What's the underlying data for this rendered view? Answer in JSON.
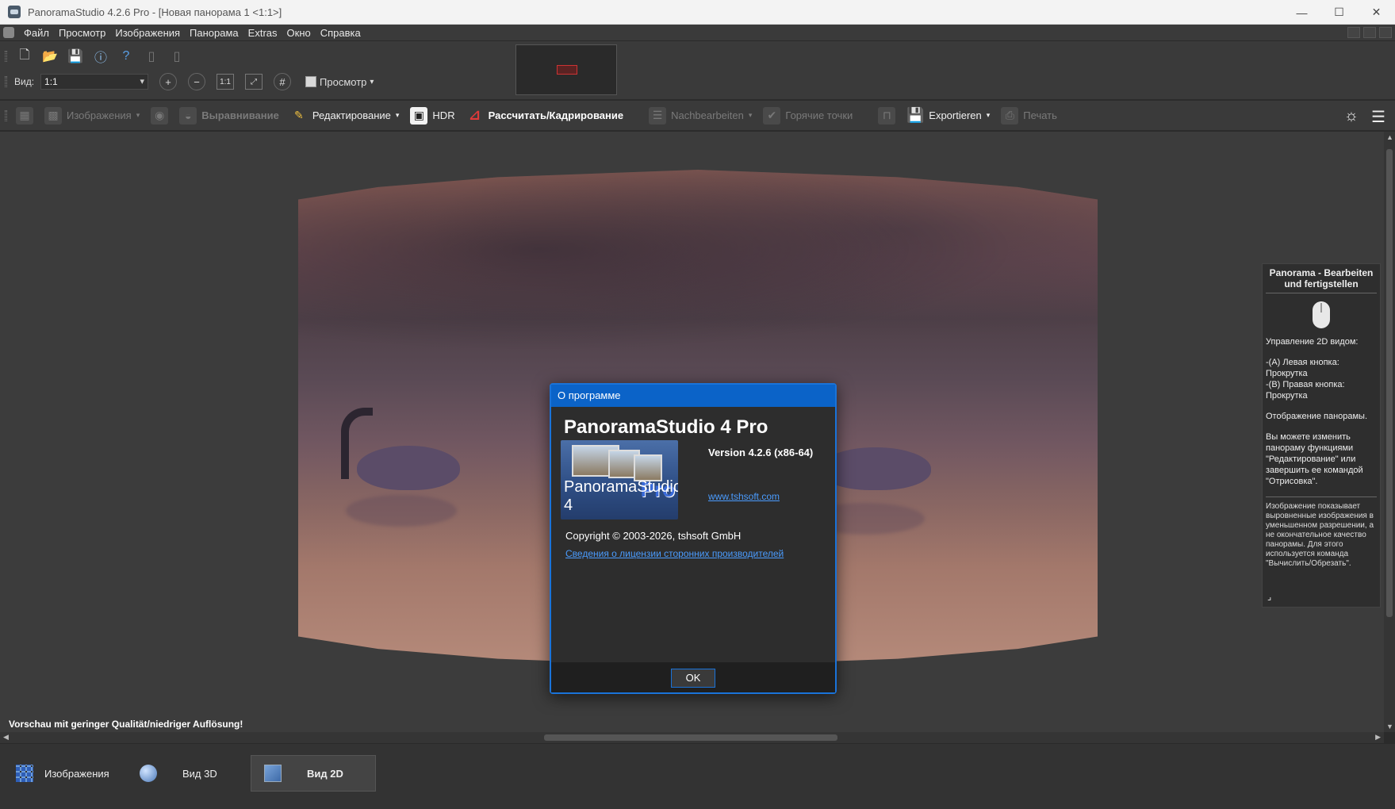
{
  "window": {
    "title": "PanoramaStudio 4.2.6 Pro - [Новая панорама 1 <1:1>]"
  },
  "menu": [
    "Файл",
    "Просмотр",
    "Изображения",
    "Панорама",
    "Extras",
    "Окно",
    "Справка"
  ],
  "toolbar": {
    "view_label": "Вид:",
    "view_value": "1:1",
    "preview_label": "Просмотр"
  },
  "workflow": {
    "images": "Изображения",
    "align": "Выравнивание",
    "edit": "Редактирование",
    "hdr": "HDR",
    "render": "Рассчитать/Кадрирование",
    "postprocess": "Nachbearbeiten",
    "hotspots": "Горячие точки",
    "export": "Exportieren",
    "print": "Печать"
  },
  "status": {
    "message": "Vorschau mit geringer Qualität/niedriger Auflösung!"
  },
  "help": {
    "title": "Panorama - Bearbeiten und fertigstellen",
    "line1": "Управление 2D видом:",
    "line2": "-(A) Левая кнопка: Прокрутка",
    "line3": "-(B) Правая кнопка: Прокрутка",
    "line4": "Отображение панорамы.",
    "line5": "Вы можете изменить панораму функциями \"Редактирование\" или завершить ее командой \"Отрисовка\".",
    "note": "Изображение показывает выровненные изображения в уменьшенном разрешении, а не окончательное качество панорамы. Для этого используется команда \"Вычислить/Обрезать\"."
  },
  "dialog": {
    "title": "О программе",
    "product": "PanoramaStudio 4 Pro",
    "version": "Version 4.2.6 (x86-64)",
    "logo_text": "PanoramaStudio 4",
    "logo_pro": "Pro",
    "website": "www.tshsoft.com",
    "copyright": "Copyright © 2003-2026, tshsoft GmbH",
    "license_link": "Сведения о лицензии сторонних производителей",
    "ok": "OK"
  },
  "tabs": {
    "images": "Изображения",
    "view3d": "Вид 3D",
    "view2d": "Вид 2D"
  }
}
